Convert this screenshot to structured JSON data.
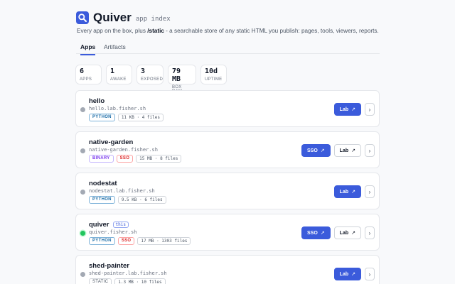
{
  "header": {
    "title": "Quiver",
    "subtitle": "app index"
  },
  "description": {
    "before": "Every app on the box, plus ",
    "strong": "/static",
    "after": " - a searchable store of any static HTML you publish: pages, tools, viewers, reports."
  },
  "tabs": [
    {
      "label": "Apps",
      "active": true
    },
    {
      "label": "Artifacts",
      "active": false
    }
  ],
  "stats": [
    {
      "value": "6",
      "label": "APPS"
    },
    {
      "value": "1",
      "label": "AWAKE"
    },
    {
      "value": "3",
      "label": "EXPOSED"
    },
    {
      "value": "79 MB",
      "label": "BOX RAM"
    },
    {
      "value": "10d",
      "label": "UPTIME"
    }
  ],
  "apps": [
    {
      "name": "hello",
      "host": "hello.lab.fisher.sh",
      "status": "grey",
      "badges": [
        {
          "text": "PYTHON",
          "kind": "python"
        },
        {
          "text": "11 KB · 4 files",
          "kind": "meta"
        }
      ],
      "buttons": [
        {
          "label": "Lab",
          "arrow": "↗",
          "style": "primary"
        }
      ],
      "chevron": "›"
    },
    {
      "name": "native-garden",
      "host": "native-garden.fisher.sh",
      "status": "grey",
      "badges": [
        {
          "text": "BINARY",
          "kind": "binary"
        },
        {
          "text": "SSO",
          "kind": "sso"
        },
        {
          "text": "15 MB · 8 files",
          "kind": "meta"
        }
      ],
      "buttons": [
        {
          "label": "SSO",
          "arrow": "↗",
          "style": "primary"
        },
        {
          "label": "Lab",
          "arrow": "↗",
          "style": "secondary"
        }
      ],
      "chevron": "›"
    },
    {
      "name": "nodestat",
      "host": "nodestat.lab.fisher.sh",
      "status": "grey",
      "badges": [
        {
          "text": "PYTHON",
          "kind": "python"
        },
        {
          "text": "9.5 KB · 6 files",
          "kind": "meta"
        }
      ],
      "buttons": [
        {
          "label": "Lab",
          "arrow": "↗",
          "style": "primary"
        }
      ],
      "chevron": "›"
    },
    {
      "name": "quiver",
      "this_label": "this",
      "host": "quiver.fisher.sh",
      "status": "green",
      "badges": [
        {
          "text": "PYTHON",
          "kind": "python"
        },
        {
          "text": "SSO",
          "kind": "sso"
        },
        {
          "text": "17 MB · 1303 files",
          "kind": "meta"
        }
      ],
      "buttons": [
        {
          "label": "SSO",
          "arrow": "↗",
          "style": "primary"
        },
        {
          "label": "Lab",
          "arrow": "↗",
          "style": "secondary"
        }
      ],
      "chevron": "›"
    },
    {
      "name": "shed-painter",
      "host": "shed-painter.lab.fisher.sh",
      "status": "grey",
      "badges": [
        {
          "text": "STATIC",
          "kind": "static"
        },
        {
          "text": "1.3 MB · 10 files",
          "kind": "meta"
        }
      ],
      "buttons": [
        {
          "label": "Lab",
          "arrow": "↗",
          "style": "primary"
        }
      ],
      "chevron": "›"
    }
  ],
  "colors": {
    "accent": "#3b5bdb",
    "awake": "#22c55e",
    "idle": "#a3a9b3"
  }
}
